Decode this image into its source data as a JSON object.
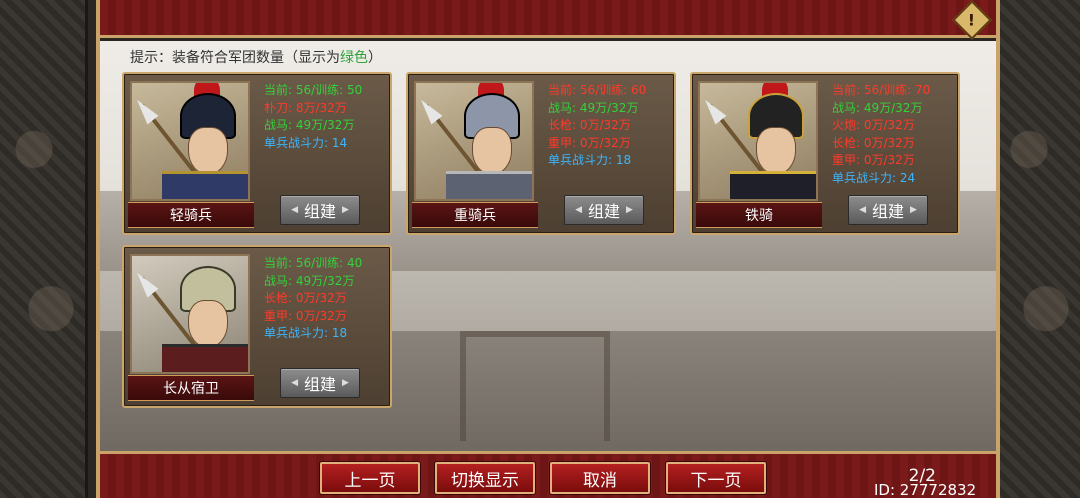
{
  "hint": {
    "prefix": "提示：装备符合军团数量（显示为",
    "green_word": "绿色",
    "suffix": "）"
  },
  "units": [
    {
      "name": "轻骑兵",
      "portrait": "light-cavalry-portrait",
      "stats": [
        {
          "label": "当前: 56/训练: 50",
          "status": "ok"
        },
        {
          "label": "朴刀: 8万/32万",
          "status": "bad"
        },
        {
          "label": "战马: 49万/32万",
          "status": "ok"
        },
        {
          "label": "单兵战斗力: 14",
          "status": "blue"
        }
      ],
      "build_label": "组建"
    },
    {
      "name": "重骑兵",
      "portrait": "heavy-cavalry-portrait",
      "stats": [
        {
          "label": "当前: 56/训练: 60",
          "status": "bad"
        },
        {
          "label": "战马: 49万/32万",
          "status": "ok"
        },
        {
          "label": "长枪: 0万/32万",
          "status": "bad"
        },
        {
          "label": "重甲: 0万/32万",
          "status": "bad"
        },
        {
          "label": "单兵战斗力: 18",
          "status": "blue"
        }
      ],
      "build_label": "组建"
    },
    {
      "name": "铁骑",
      "portrait": "iron-cavalry-portrait",
      "stats": [
        {
          "label": "当前: 56/训练: 70",
          "status": "bad"
        },
        {
          "label": "战马: 49万/32万",
          "status": "ok"
        },
        {
          "label": "火炮: 0万/32万",
          "status": "bad"
        },
        {
          "label": "长枪: 0万/32万",
          "status": "bad"
        },
        {
          "label": "重甲: 0万/32万",
          "status": "bad"
        },
        {
          "label": "单兵战斗力: 24",
          "status": "blue"
        }
      ],
      "build_label": "组建"
    },
    {
      "name": "长从宿卫",
      "portrait": "guard-portrait",
      "stats": [
        {
          "label": "当前: 56/训练: 40",
          "status": "ok"
        },
        {
          "label": "战马: 49万/32万",
          "status": "ok"
        },
        {
          "label": "长枪: 0万/32万",
          "status": "bad"
        },
        {
          "label": "重甲: 0万/32万",
          "status": "bad"
        },
        {
          "label": "单兵战斗力: 18",
          "status": "blue"
        }
      ],
      "build_label": "组建"
    }
  ],
  "nav": {
    "prev": "上一页",
    "toggle": "切换显示",
    "cancel": "取消",
    "next": "下一页"
  },
  "page": "2/2",
  "uid": "ID: 27772832",
  "alert_icon": "!"
}
